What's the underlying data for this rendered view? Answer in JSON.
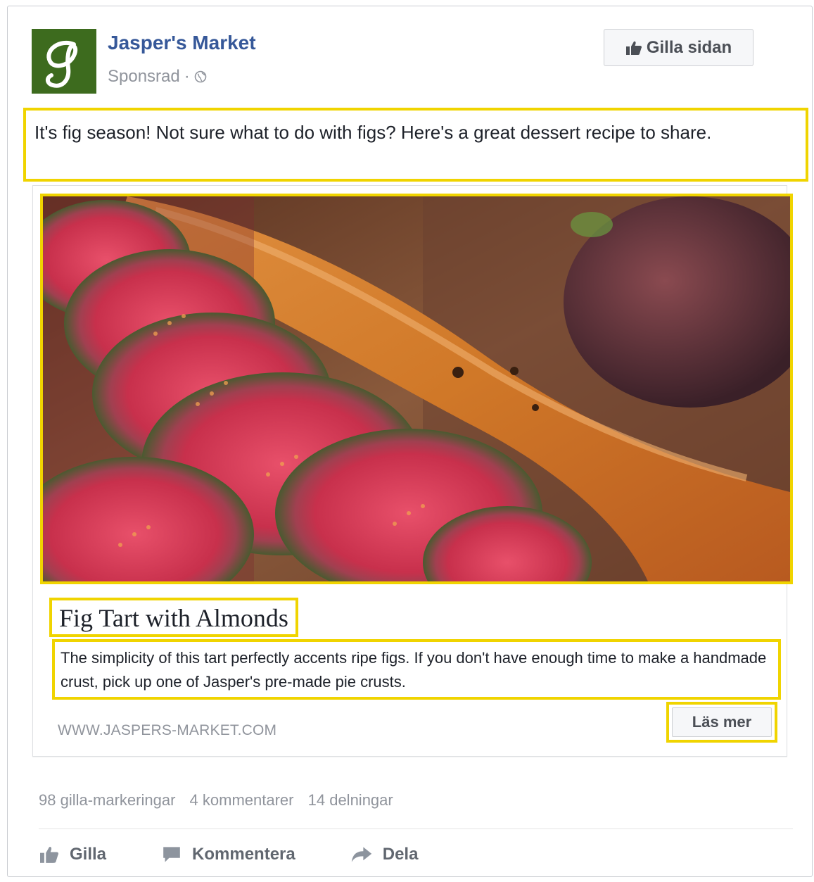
{
  "post": {
    "page_name": "Jasper's Market",
    "sponsored_label": "Sponsrad",
    "separator": "·",
    "like_page_label": "Gilla sidan",
    "caption": "It's fig season! Not sure what to do with figs? Here's a great dessert recipe to share."
  },
  "link": {
    "title": "Fig Tart with Almonds",
    "description": "The simplicity of this tart perfectly accents ripe figs. If you don't have enough time to make a handmade crust, pick up one of Jasper's pre-made pie crusts.",
    "domain": "WWW.JASPERS-MARKET.COM",
    "cta_label": "Läs mer"
  },
  "stats": {
    "likes": "98 gilla-markeringar",
    "comments": "4 kommentarer",
    "shares": "14 delningar"
  },
  "actions": {
    "like": "Gilla",
    "comment": "Kommentera",
    "share": "Dela"
  },
  "icons": {
    "thumbs_up": "thumbs-up-icon",
    "globe": "globe-icon",
    "comment": "speech-bubble-icon",
    "share": "share-arrow-icon"
  },
  "colors": {
    "page_name": "#365899",
    "highlight": "#f0d400",
    "logo_bg": "#3d6b1e",
    "secondary_text": "#90949c"
  }
}
